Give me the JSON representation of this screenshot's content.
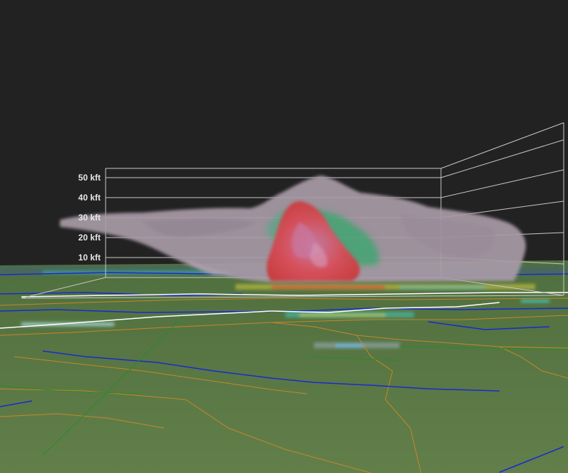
{
  "altitude_axis": {
    "unit_labels": [
      "10 kft",
      "20 kft",
      "30 kft",
      "40 kft",
      "50 kft"
    ]
  },
  "colors": {
    "sky": "#222222",
    "ground": "#5b7a45",
    "grid_lines": "#c8c8c8",
    "altitude_label_text": "#e6e6e6",
    "cloud_volume": "#a89aa6",
    "high_reflectivity_core": "#d94a4a",
    "core_highlight": "#c878a0",
    "moderate_reflectivity": "#2fa86a",
    "state_boundaries": "#c8862a",
    "rivers": "#1a2ad0",
    "roads": "#2a8a2a",
    "highway": "#ffffff"
  }
}
